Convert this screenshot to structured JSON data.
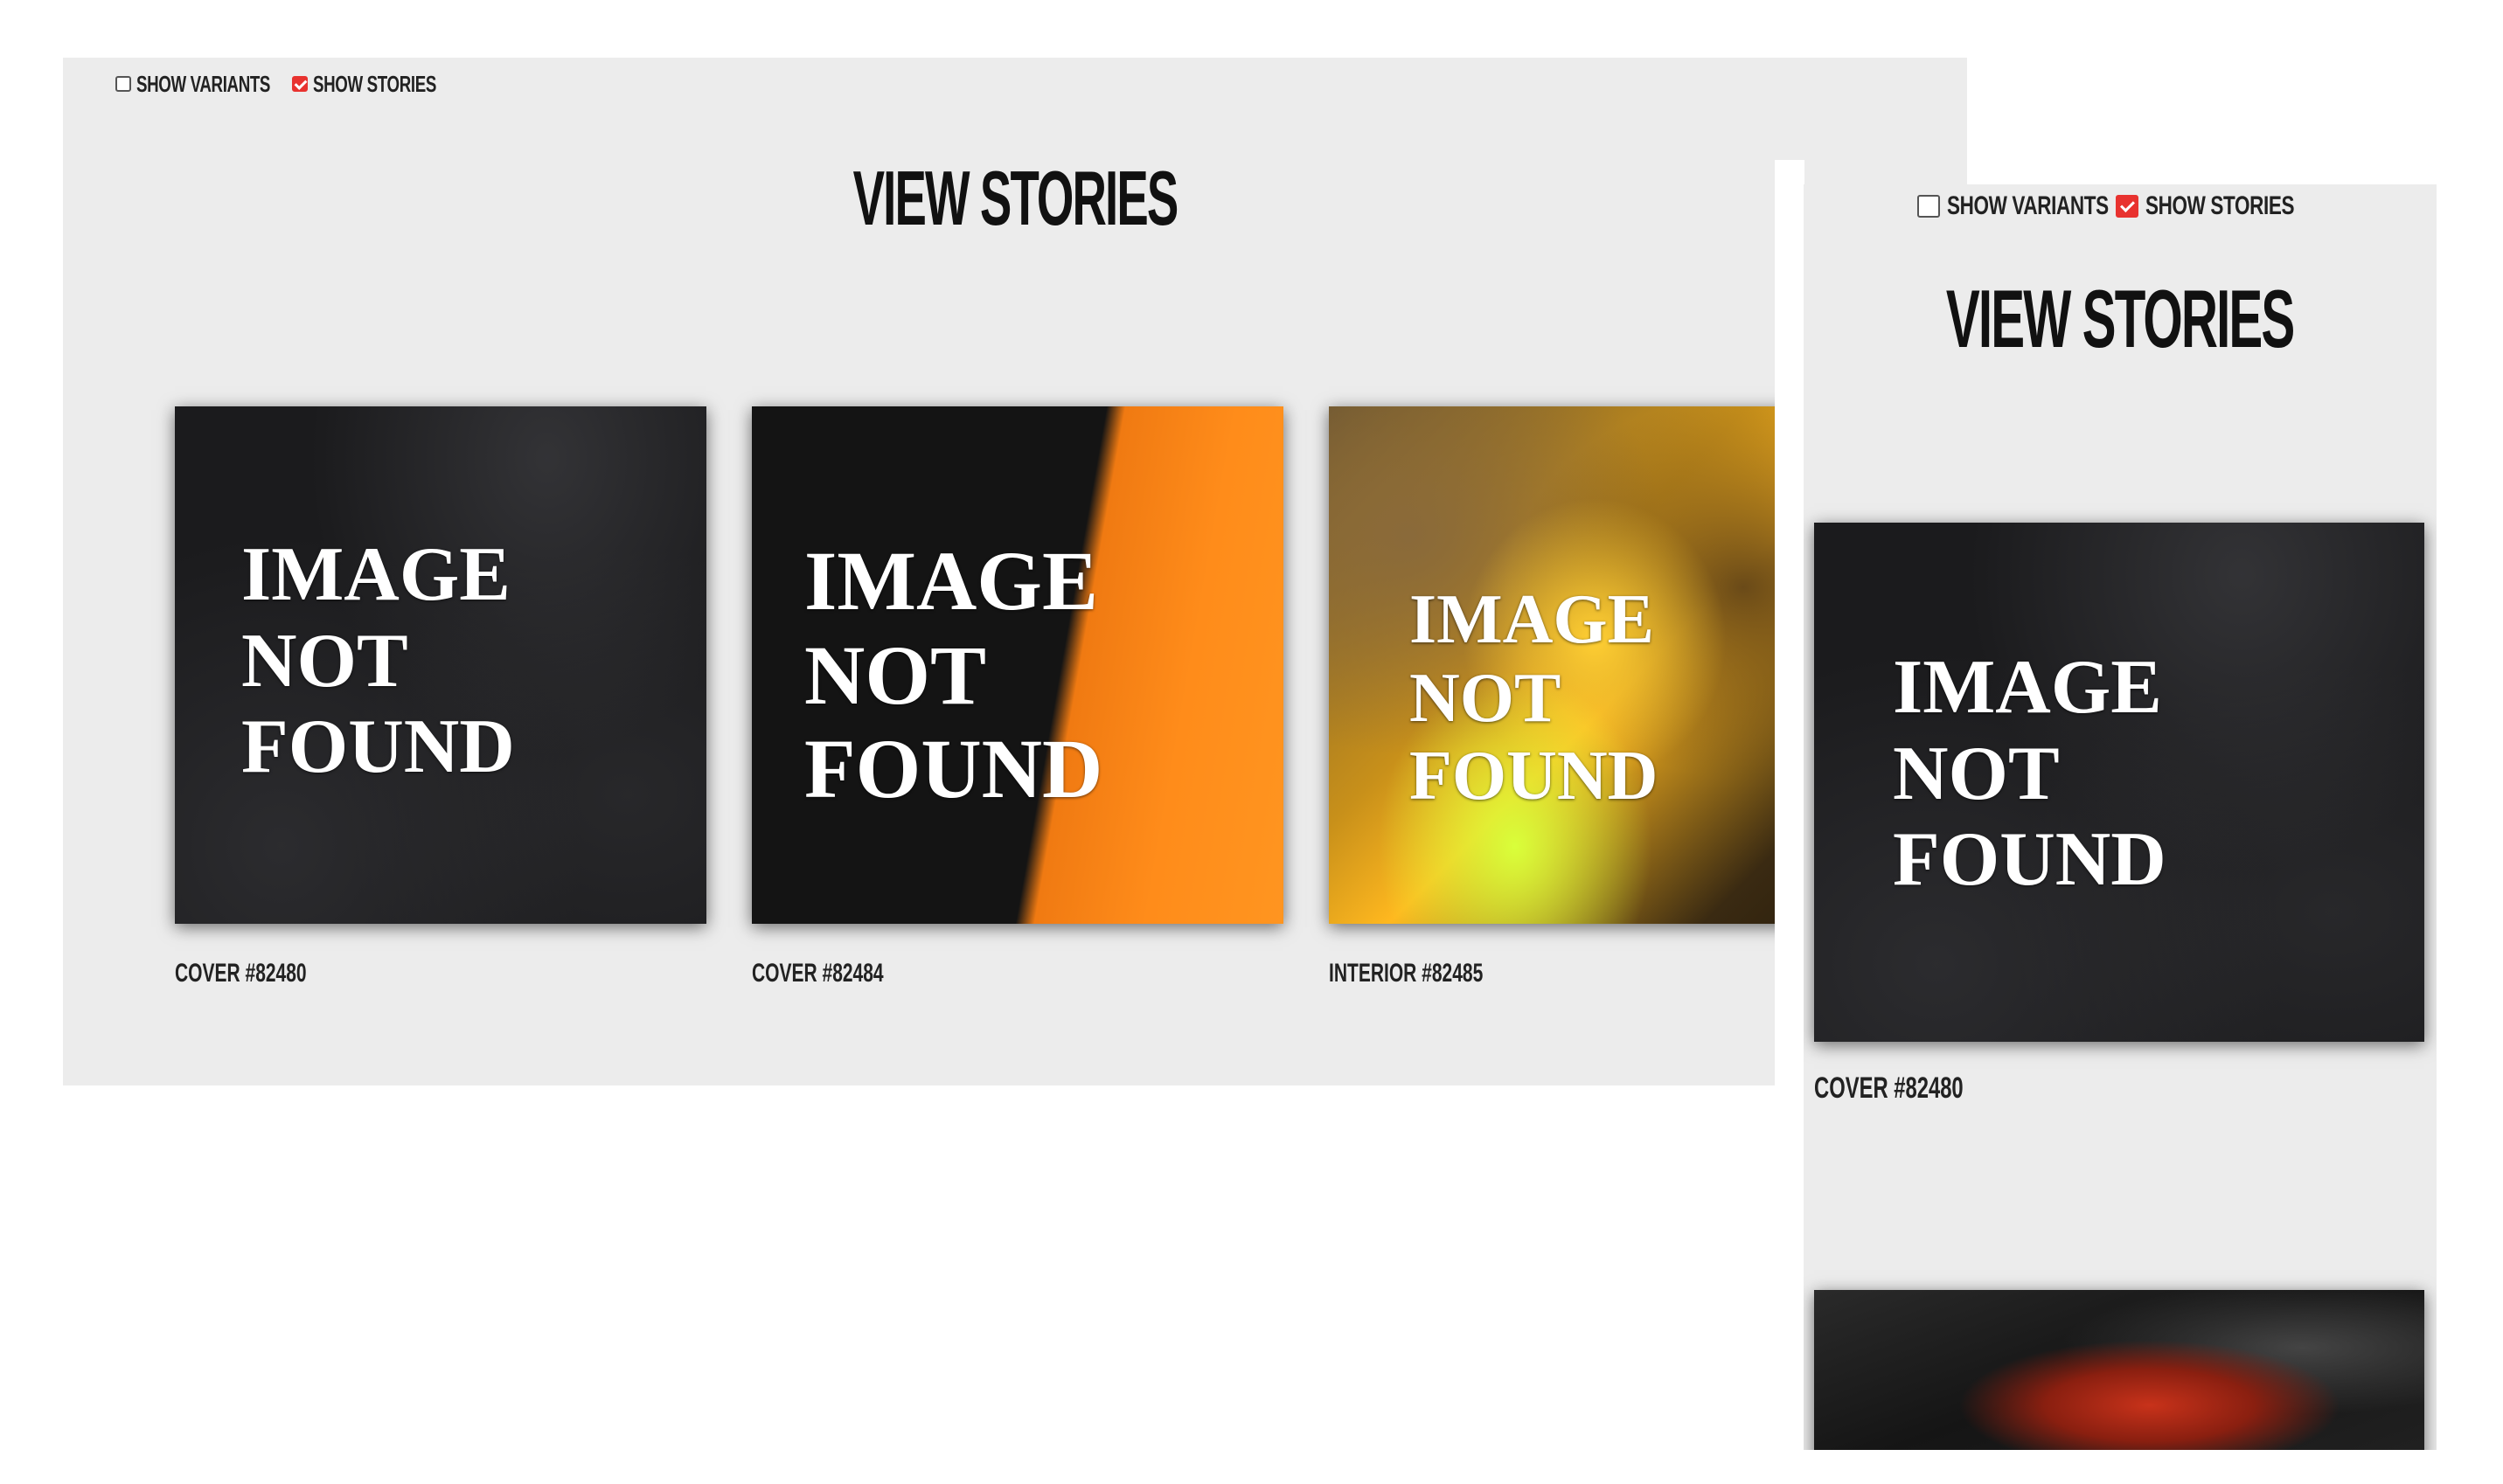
{
  "desktop": {
    "controls": {
      "show_variants": {
        "label": "SHOW VARIANTS",
        "checked": false
      },
      "show_stories": {
        "label": "SHOW STORIES",
        "checked": true
      }
    },
    "title": "VIEW STORIES",
    "cards": [
      {
        "image_text": [
          "IMAGE",
          "NOT",
          "FOUND"
        ],
        "caption": "COVER #82480",
        "background": "dark-texture"
      },
      {
        "image_text": [
          "IMAGE",
          "NOT",
          "FOUND"
        ],
        "caption": "COVER #82484",
        "background": "black-orange-split"
      },
      {
        "image_text": [
          "IMAGE",
          "NOT",
          "FOUND"
        ],
        "caption": "INTERIOR #82485",
        "background": "gold-marble"
      }
    ]
  },
  "mobile": {
    "controls": {
      "show_variants": {
        "label": "SHOW VARIANTS",
        "checked": false
      },
      "show_stories": {
        "label": "SHOW STORIES",
        "checked": true
      }
    },
    "title": "VIEW STORIES",
    "cards": [
      {
        "image_text": [
          "IMAGE",
          "NOT",
          "FOUND"
        ],
        "caption": "COVER #82480",
        "background": "dark-texture"
      },
      {
        "background": "red-black-paint"
      }
    ]
  },
  "colors": {
    "panel_background": "#ececec",
    "checkbox_checked": "#e8322f",
    "accent_orange": "#ff8c1a",
    "text_dark": "#111111"
  }
}
